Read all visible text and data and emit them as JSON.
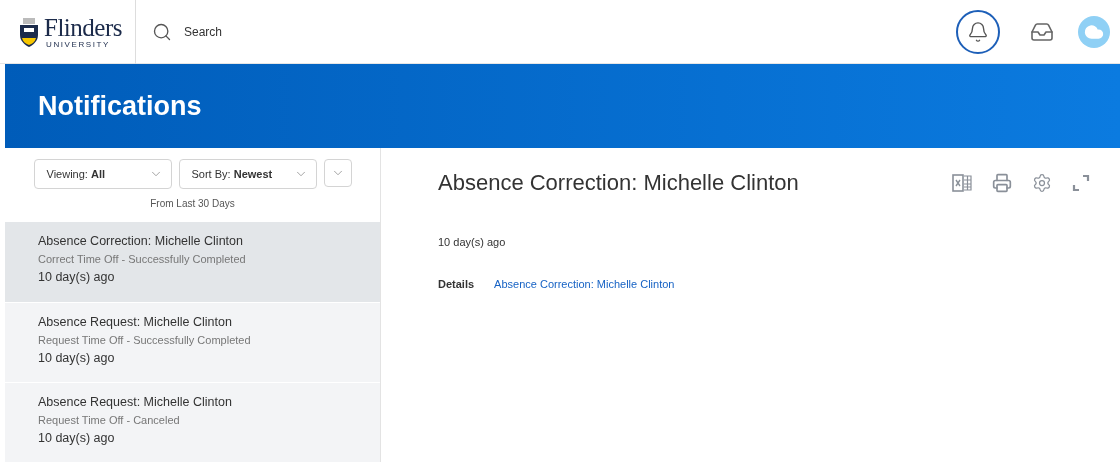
{
  "header": {
    "logo": {
      "name": "Flinders",
      "subtitle": "UNIVERSITY"
    },
    "search": {
      "placeholder": "Search"
    },
    "notifications_active": true
  },
  "page_title": "Notifications",
  "filters": [
    {
      "label": "Viewing:",
      "value": "All"
    },
    {
      "label": "Sort By:",
      "value": "Newest"
    }
  ],
  "filter_note": "From Last 30 Days",
  "notifications": [
    {
      "title": "Absence Correction: Michelle Clinton",
      "subtitle": "Correct Time Off - Successfully Completed",
      "time": "10 day(s) ago",
      "selected": true
    },
    {
      "title": "Absence Request: Michelle Clinton",
      "subtitle": "Request Time Off - Successfully Completed",
      "time": "10 day(s) ago",
      "selected": false
    },
    {
      "title": "Absence Request: Michelle Clinton",
      "subtitle": "Request Time Off - Canceled",
      "time": "10 day(s) ago",
      "selected": false
    }
  ],
  "detail": {
    "title": "Absence Correction: Michelle Clinton",
    "time": "10 day(s) ago",
    "details_label": "Details",
    "details_link": "Absence Correction: Michelle Clinton"
  }
}
